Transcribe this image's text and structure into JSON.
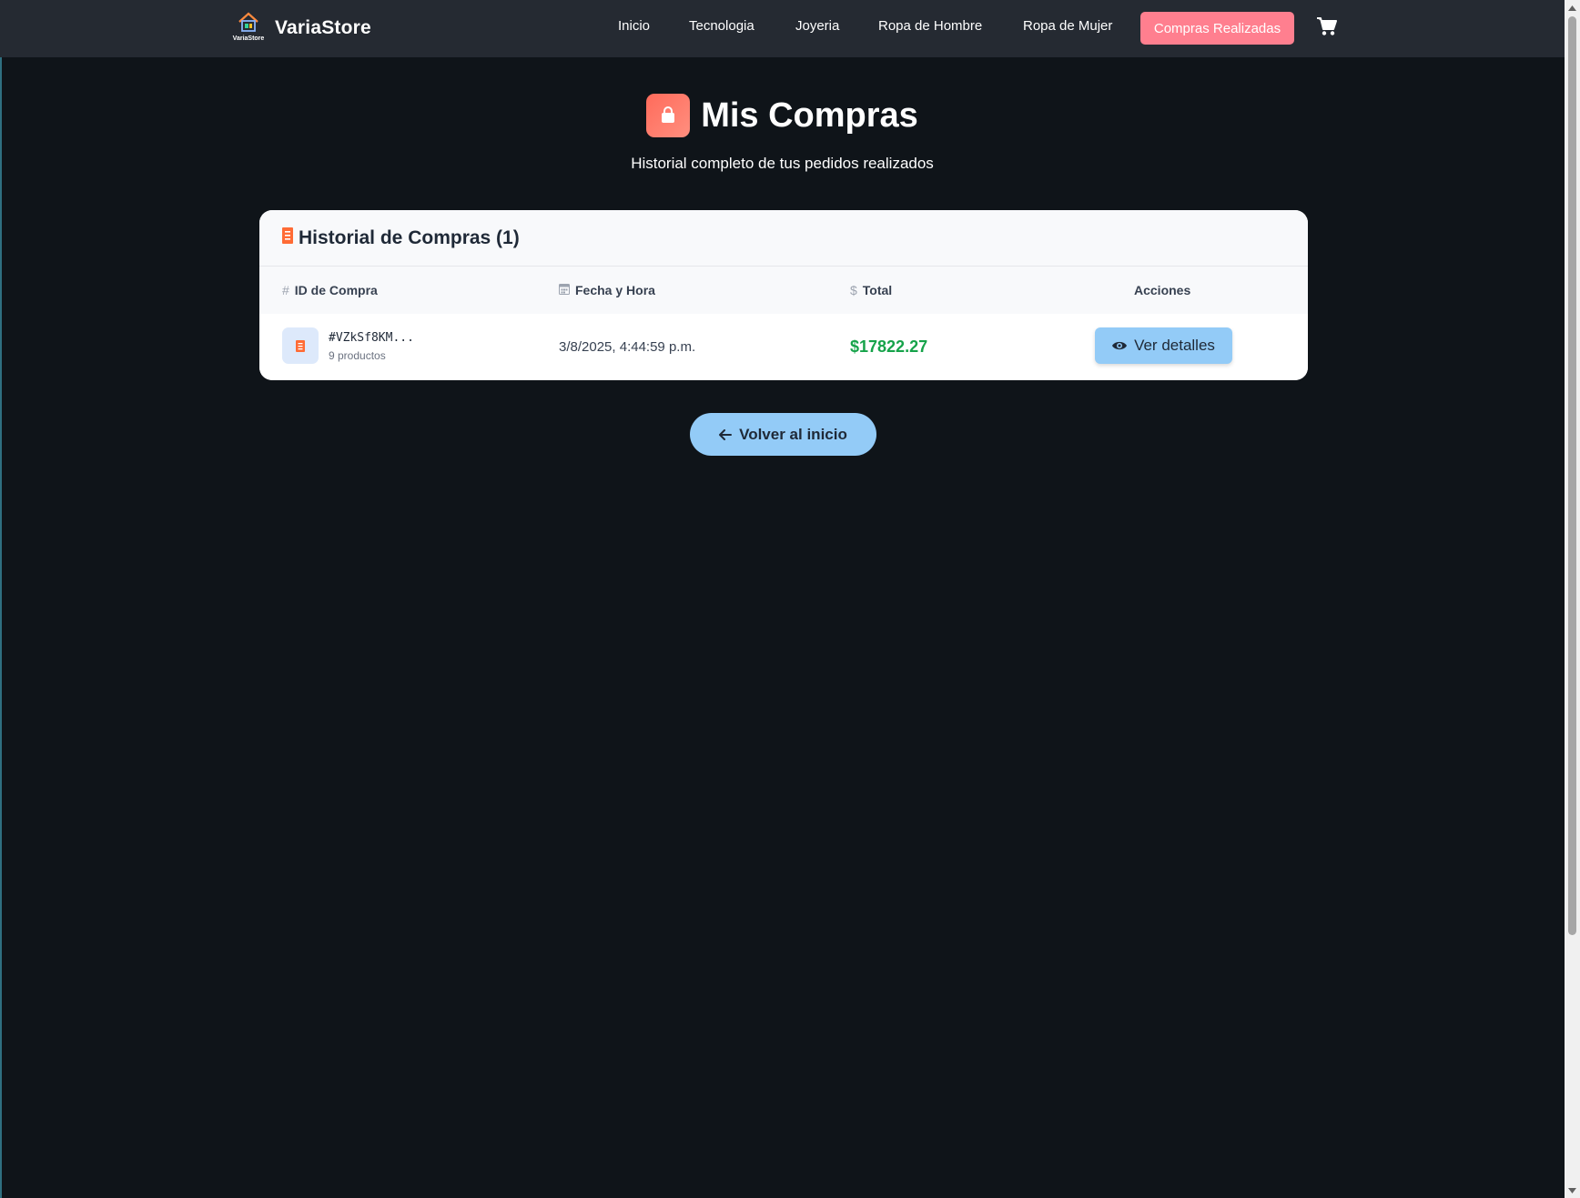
{
  "brand": {
    "name": "VariaStore",
    "logo_text": "VariaStore"
  },
  "nav": {
    "items": [
      {
        "label": "Inicio"
      },
      {
        "label": "Tecnologia"
      },
      {
        "label": "Joyeria"
      },
      {
        "label": "Ropa de Hombre"
      },
      {
        "label": "Ropa de Mujer"
      }
    ],
    "active": {
      "label": "Compras Realizadas"
    },
    "cart_icon": "shopping-cart-icon"
  },
  "header": {
    "title": "Mis Compras",
    "subtitle": "Historial completo de tus pedidos realizados",
    "icon": "shopping-bag-icon"
  },
  "history": {
    "title": "Historial de Compras (1)",
    "columns": [
      {
        "icon": "#",
        "label": "ID de Compra"
      },
      {
        "icon": "calendar-icon",
        "label": "Fecha y Hora"
      },
      {
        "icon": "$",
        "label": "Total"
      },
      {
        "label": "Acciones"
      }
    ],
    "rows": [
      {
        "id": "#VZkSf8KM...",
        "count": "9 productos",
        "date": "3/8/2025, 4:44:59 p.m.",
        "total": "$17822.27",
        "action": "Ver detalles"
      }
    ]
  },
  "back_button": {
    "label": "Volver al inicio"
  },
  "colors": {
    "background": "#0f1419",
    "navbar": "#252a32",
    "active_nav": "#ff7f8f",
    "accent_orange": "#ff6b5b",
    "total_green": "#16a34a",
    "button_blue": "#93cbf7"
  }
}
